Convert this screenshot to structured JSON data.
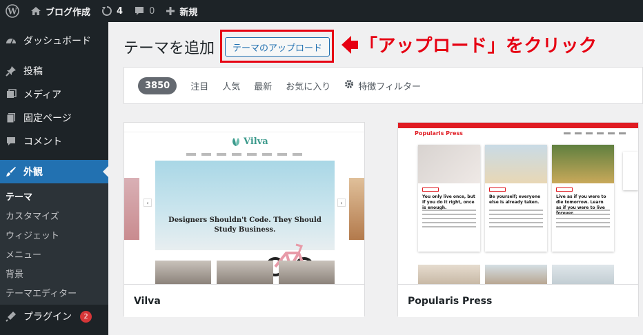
{
  "adminbar": {
    "site_name": "ブログ作成",
    "updates_count": "4",
    "comments_count": "0",
    "new_label": "新規"
  },
  "sidebar": {
    "items": [
      {
        "label": "ダッシュボード",
        "icon": "dashboard-icon"
      },
      {
        "label": "投稿",
        "icon": "pin-icon"
      },
      {
        "label": "メディア",
        "icon": "media-icon"
      },
      {
        "label": "固定ページ",
        "icon": "page-icon"
      },
      {
        "label": "コメント",
        "icon": "comment-icon"
      },
      {
        "label": "外観",
        "icon": "brush-icon",
        "active": true
      }
    ],
    "submenu": [
      "テーマ",
      "カスタマイズ",
      "ウィジェット",
      "メニュー",
      "背景",
      "テーマエディター"
    ],
    "plugins": {
      "label": "プラグイン",
      "badge": "2",
      "icon": "plugin-icon"
    }
  },
  "header": {
    "title": "テーマを追加",
    "upload_button": "テーマのアップロード"
  },
  "annotation": {
    "text": "「アップロード」をクリック",
    "color": "#e60012"
  },
  "filters": {
    "count": "3850",
    "tabs": [
      "注目",
      "人気",
      "最新",
      "お気に入り"
    ],
    "feature_filter": "特徴フィルター"
  },
  "themes": [
    {
      "name": "Vilva",
      "preview": {
        "logo": "Vilva",
        "hero_caption_line1": "Designers Shouldn't Code. They Should",
        "hero_caption_line2": "Study Business."
      }
    },
    {
      "name": "Popularis Press",
      "preview": {
        "logo": "Popularis Press",
        "posts": [
          "You only live once, but if you do it right, once is enough.",
          "Be yourself; everyone else is already taken.",
          "Live as if you were to die tomorrow. Learn as if you were to live forever."
        ]
      }
    }
  ],
  "colors": {
    "admin_dark": "#1d2327",
    "accent": "#2271b1",
    "badge": "#d63638"
  }
}
